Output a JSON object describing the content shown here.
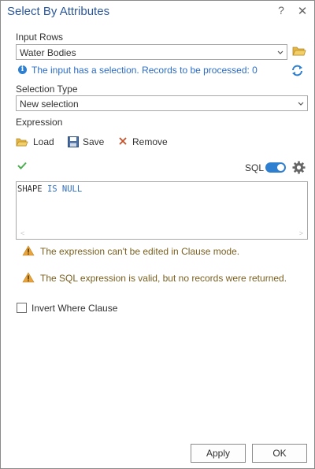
{
  "window": {
    "title": "Select By Attributes",
    "help_label": "?",
    "close_label": "✕"
  },
  "input_rows": {
    "label": "Input Rows",
    "value": "Water Bodies"
  },
  "info": {
    "message": "The input has a selection. Records to be processed: 0"
  },
  "selection_type": {
    "label": "Selection Type",
    "value": "New selection"
  },
  "expression": {
    "label": "Expression",
    "toolbar": {
      "load_label": "Load",
      "save_label": "Save",
      "remove_label": "Remove"
    },
    "sql_label": "SQL",
    "sql_enabled": true,
    "code": {
      "field": "SHAPE",
      "operator": "IS NULL"
    }
  },
  "messages": [
    {
      "text": "The expression can't be edited in Clause mode."
    },
    {
      "text": "The SQL expression is valid, but no records were returned."
    }
  ],
  "invert": {
    "label": "Invert Where Clause",
    "checked": false
  },
  "buttons": {
    "apply_label": "Apply",
    "ok_label": "OK"
  },
  "colors": {
    "accent": "#2e7fd0",
    "title": "#2b579a",
    "warning": "#e8a33d",
    "success": "#4caf50",
    "remove": "#c8502a"
  }
}
